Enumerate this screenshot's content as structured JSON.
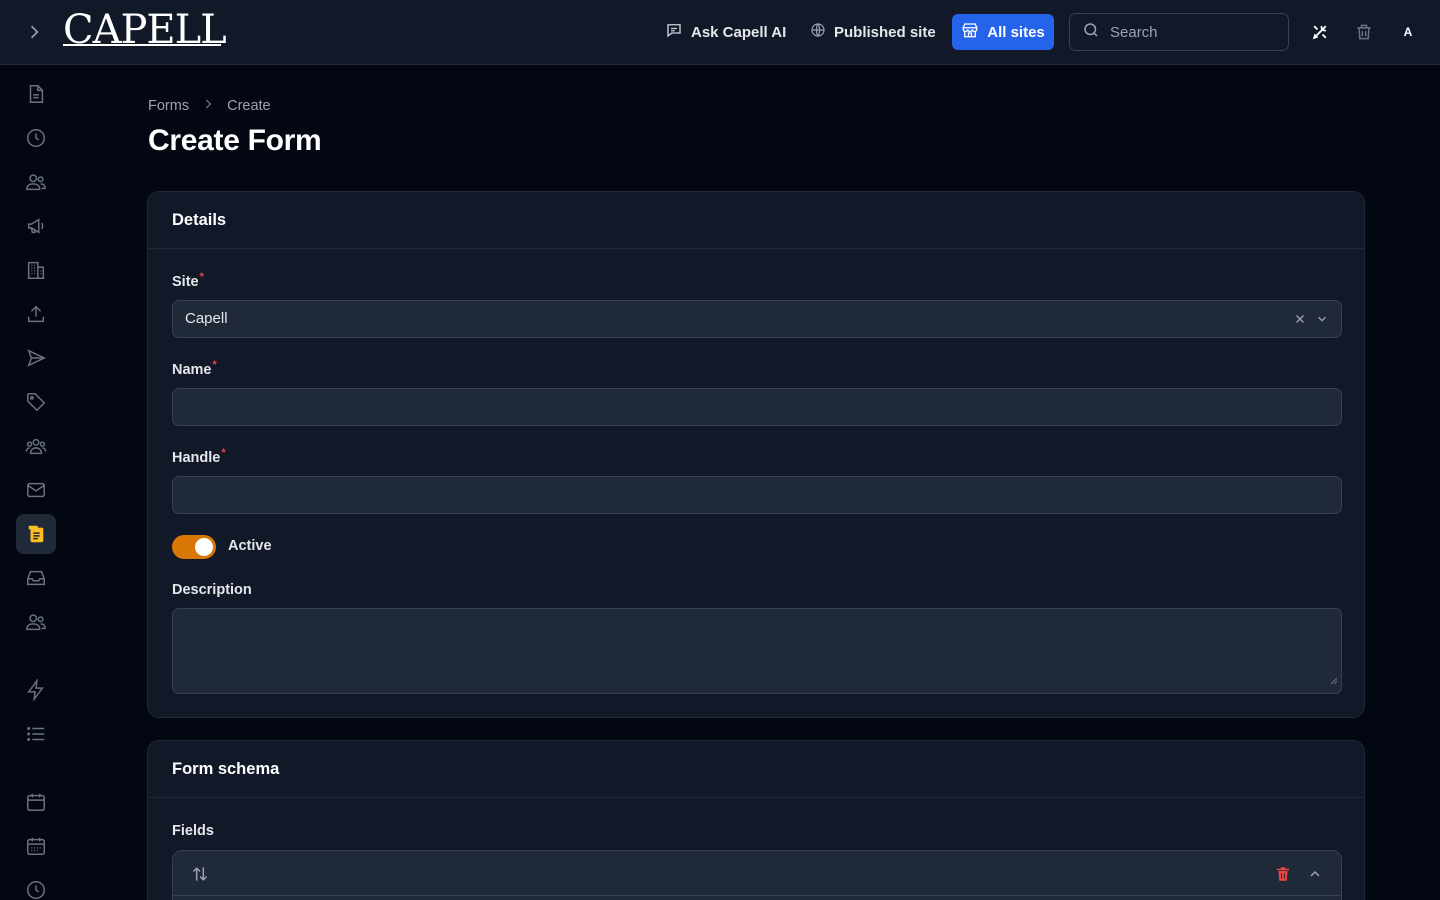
{
  "header": {
    "logo_text": "CAPELL",
    "ask_ai_label": "Ask Capell AI",
    "published_site_label": "Published site",
    "all_sites_label": "All sites",
    "search_placeholder": "Search",
    "avatar_initial": "A"
  },
  "sidebar": {
    "active_index": 10,
    "items": [
      {
        "icon": "document-icon"
      },
      {
        "icon": "clock-icon"
      },
      {
        "icon": "users-icon"
      },
      {
        "icon": "megaphone-icon"
      },
      {
        "icon": "building-icon"
      },
      {
        "icon": "upload-icon"
      },
      {
        "icon": "paper-plane-icon"
      },
      {
        "icon": "tag-icon"
      },
      {
        "icon": "user-group-icon"
      },
      {
        "icon": "envelope-icon"
      },
      {
        "icon": "clipboard-icon"
      },
      {
        "icon": "inbox-icon"
      },
      {
        "icon": "users-icon"
      },
      {
        "icon": "bolt-icon"
      },
      {
        "icon": "list-icon"
      },
      {
        "icon": "calendar-icon"
      },
      {
        "icon": "calendar-days-icon"
      },
      {
        "icon": "clock-icon"
      }
    ]
  },
  "breadcrumb": {
    "items": [
      "Forms",
      "Create"
    ]
  },
  "page": {
    "title": "Create Form"
  },
  "details": {
    "heading": "Details",
    "site_label": "Site",
    "site_value": "Capell",
    "name_label": "Name",
    "name_value": "",
    "handle_label": "Handle",
    "handle_value": "",
    "active_label": "Active",
    "active_on": true,
    "description_label": "Description",
    "description_value": ""
  },
  "schema": {
    "heading": "Form schema",
    "fields_label": "Fields"
  },
  "colors": {
    "accent_blue": "#2563eb",
    "toggle_on": "#d97706",
    "active_icon": "#fbbf24",
    "danger": "#ef4444"
  }
}
